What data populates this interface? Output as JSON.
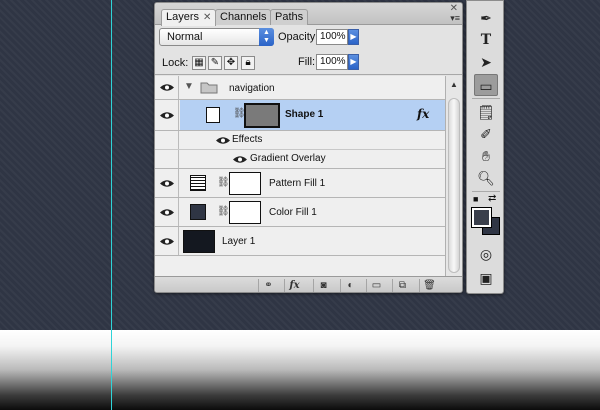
{
  "layers_panel": {
    "tabs": [
      {
        "label": "Layers",
        "active": true
      },
      {
        "label": "Channels",
        "active": false
      },
      {
        "label": "Paths",
        "active": false
      }
    ],
    "blend_mode": "Normal",
    "opacity_label": "Opacity:",
    "opacity_value": "100%",
    "lock_label": "Lock:",
    "fill_label": "Fill:",
    "fill_value": "100%",
    "layers": [
      {
        "name": "navigation",
        "kind": "group",
        "expanded": true
      },
      {
        "name": "Shape 1",
        "kind": "shape",
        "selected": true,
        "fx": "fx"
      },
      {
        "name": "Effects",
        "kind": "effects-header"
      },
      {
        "name": "Gradient Overlay",
        "kind": "effect"
      },
      {
        "name": "Pattern Fill 1",
        "kind": "fill"
      },
      {
        "name": "Color Fill 1",
        "kind": "fill",
        "color": "#2f3544"
      },
      {
        "name": "Layer 1",
        "kind": "pixel",
        "color": "#141820"
      }
    ],
    "bottom_buttons": [
      "link-icon",
      "fx-icon",
      "mask-icon",
      "adjustment-icon",
      "folder-icon",
      "new-layer-icon",
      "trash-icon"
    ],
    "fx_button": "fx"
  },
  "canvas": {
    "background_color": "#2f3544",
    "guide_color": "#2fd4d8"
  }
}
